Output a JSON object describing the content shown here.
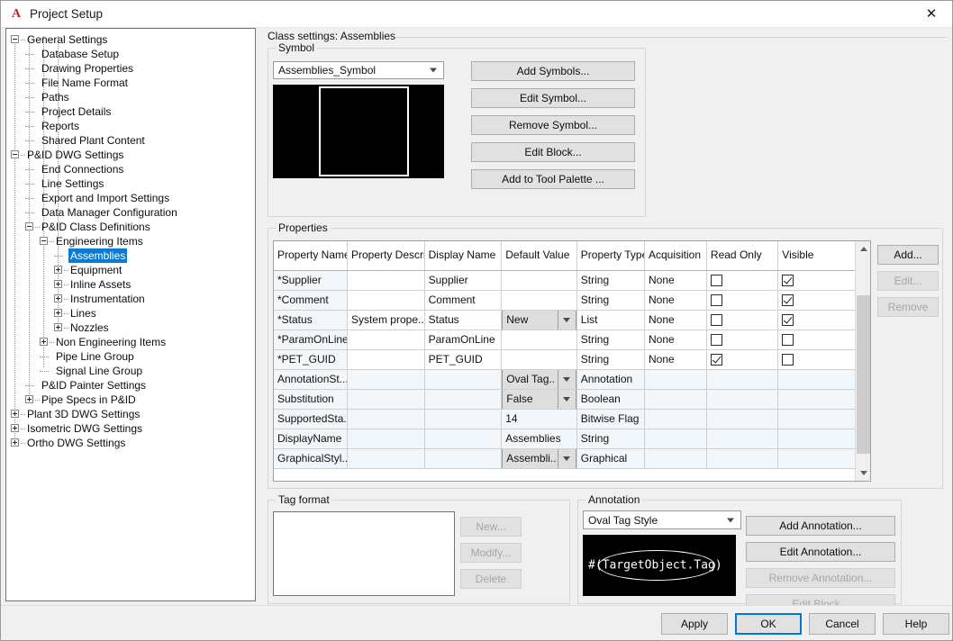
{
  "window": {
    "title": "Project Setup",
    "app_icon": "autocad-a-icon",
    "close_label": "✕"
  },
  "tree": {
    "nodes": [
      {
        "label": "General Settings",
        "depth": 0,
        "toggle": "minus",
        "selected": false
      },
      {
        "label": "Database Setup",
        "depth": 1,
        "toggle": "none",
        "selected": false
      },
      {
        "label": "Drawing Properties",
        "depth": 1,
        "toggle": "none",
        "selected": false
      },
      {
        "label": "File Name Format",
        "depth": 1,
        "toggle": "none",
        "selected": false
      },
      {
        "label": "Paths",
        "depth": 1,
        "toggle": "none",
        "selected": false
      },
      {
        "label": "Project Details",
        "depth": 1,
        "toggle": "none",
        "selected": false
      },
      {
        "label": "Reports",
        "depth": 1,
        "toggle": "none",
        "selected": false
      },
      {
        "label": "Shared Plant Content",
        "depth": 1,
        "toggle": "none",
        "selected": false
      },
      {
        "label": "P&ID DWG Settings",
        "depth": 0,
        "toggle": "minus",
        "selected": false
      },
      {
        "label": "End Connections",
        "depth": 1,
        "toggle": "none",
        "selected": false
      },
      {
        "label": "Line Settings",
        "depth": 1,
        "toggle": "none",
        "selected": false
      },
      {
        "label": "Export and Import Settings",
        "depth": 1,
        "toggle": "none",
        "selected": false
      },
      {
        "label": "Data Manager Configuration",
        "depth": 1,
        "toggle": "none",
        "selected": false
      },
      {
        "label": "P&ID Class Definitions",
        "depth": 1,
        "toggle": "minus",
        "selected": false
      },
      {
        "label": "Engineering Items",
        "depth": 2,
        "toggle": "minus",
        "selected": false
      },
      {
        "label": "Assemblies",
        "depth": 3,
        "toggle": "none",
        "selected": true
      },
      {
        "label": "Equipment",
        "depth": 3,
        "toggle": "plus",
        "selected": false
      },
      {
        "label": "Inline Assets",
        "depth": 3,
        "toggle": "plus",
        "selected": false
      },
      {
        "label": "Instrumentation",
        "depth": 3,
        "toggle": "plus",
        "selected": false
      },
      {
        "label": "Lines",
        "depth": 3,
        "toggle": "plus",
        "selected": false
      },
      {
        "label": "Nozzles",
        "depth": 3,
        "toggle": "plus",
        "selected": false
      },
      {
        "label": "Non Engineering Items",
        "depth": 2,
        "toggle": "plus",
        "selected": false
      },
      {
        "label": "Pipe Line Group",
        "depth": 2,
        "toggle": "none",
        "selected": false
      },
      {
        "label": "Signal Line Group",
        "depth": 2,
        "toggle": "none",
        "selected": false
      },
      {
        "label": "P&ID Painter Settings",
        "depth": 1,
        "toggle": "none",
        "selected": false
      },
      {
        "label": "Pipe Specs in P&ID",
        "depth": 1,
        "toggle": "plus",
        "selected": false
      },
      {
        "label": "Plant 3D DWG Settings",
        "depth": 0,
        "toggle": "plus",
        "selected": false
      },
      {
        "label": "Isometric DWG Settings",
        "depth": 0,
        "toggle": "plus",
        "selected": false
      },
      {
        "label": "Ortho DWG Settings",
        "depth": 0,
        "toggle": "plus",
        "selected": false
      }
    ]
  },
  "content": {
    "class_settings_label": "Class settings: Assemblies",
    "symbol": {
      "group_title": "Symbol",
      "combo_value": "Assemblies_Symbol",
      "buttons": [
        {
          "label": "Add Symbols...",
          "disabled": false
        },
        {
          "label": "Edit Symbol...",
          "disabled": false
        },
        {
          "label": "Remove Symbol...",
          "disabled": false
        },
        {
          "label": "Edit Block...",
          "disabled": false
        },
        {
          "label": "Add to Tool Palette ...",
          "disabled": false
        }
      ]
    },
    "properties": {
      "group_title": "Properties",
      "columns": [
        "Property Name",
        "Property Description",
        "Display Name",
        "Default Value",
        "Property Type",
        "Acquisition",
        "Read Only",
        "Visible"
      ],
      "rows": [
        {
          "name": "*Supplier",
          "description": "",
          "display": "Supplier",
          "default": "",
          "default_kind": "text",
          "type": "String",
          "acquisition": "None",
          "read_only": false,
          "visible": true,
          "has_checks": true,
          "tinted": false
        },
        {
          "name": "*Comment",
          "description": "",
          "display": "Comment",
          "default": "",
          "default_kind": "text",
          "type": "String",
          "acquisition": "None",
          "read_only": false,
          "visible": true,
          "has_checks": true,
          "tinted": false
        },
        {
          "name": "*Status",
          "description": "System prope...",
          "display": "Status",
          "default": "New",
          "default_kind": "combo",
          "type": "List",
          "acquisition": "None",
          "read_only": false,
          "visible": true,
          "has_checks": true,
          "tinted": false
        },
        {
          "name": "*ParamOnLine",
          "description": "",
          "display": "ParamOnLine",
          "default": "",
          "default_kind": "text",
          "type": "String",
          "acquisition": "None",
          "read_only": false,
          "visible": false,
          "has_checks": true,
          "tinted": false
        },
        {
          "name": "*PET_GUID",
          "description": "",
          "display": "PET_GUID",
          "default": "",
          "default_kind": "text",
          "type": "String",
          "acquisition": "None",
          "read_only": true,
          "visible": false,
          "has_checks": true,
          "tinted": false
        },
        {
          "name": "AnnotationSt...",
          "description": "",
          "display": "",
          "default": "Oval Tag...",
          "default_kind": "combo",
          "type": "Annotation",
          "acquisition": "",
          "read_only": null,
          "visible": null,
          "has_checks": false,
          "tinted": true
        },
        {
          "name": "Substitution",
          "description": "",
          "display": "",
          "default": "False",
          "default_kind": "combo",
          "type": "Boolean",
          "acquisition": "",
          "read_only": null,
          "visible": null,
          "has_checks": false,
          "tinted": true
        },
        {
          "name": "SupportedSta...",
          "description": "",
          "display": "",
          "default": "14",
          "default_kind": "text",
          "type": "Bitwise Flag",
          "acquisition": "",
          "read_only": null,
          "visible": null,
          "has_checks": false,
          "tinted": true
        },
        {
          "name": "DisplayName",
          "description": "",
          "display": "",
          "default": "Assemblies",
          "default_kind": "text",
          "type": "String",
          "acquisition": "",
          "read_only": null,
          "visible": null,
          "has_checks": false,
          "tinted": true
        },
        {
          "name": "GraphicalStyl...",
          "description": "",
          "display": "",
          "default": "Assembli...",
          "default_kind": "combo",
          "type": "Graphical",
          "acquisition": "",
          "read_only": null,
          "visible": null,
          "has_checks": false,
          "tinted": true
        }
      ],
      "buttons": [
        {
          "label": "Add...",
          "disabled": false
        },
        {
          "label": "Edit...",
          "disabled": true
        },
        {
          "label": "Remove",
          "disabled": true
        }
      ]
    },
    "tag_format": {
      "group_title": "Tag format",
      "list_items": [],
      "buttons": [
        {
          "label": "New...",
          "disabled": true
        },
        {
          "label": "Modify...",
          "disabled": true
        },
        {
          "label": "Delete",
          "disabled": true
        }
      ]
    },
    "annotation": {
      "group_title": "Annotation",
      "combo_value": "Oval Tag Style",
      "preview_text": "#(TargetObject.Tag)",
      "buttons": [
        {
          "label": "Add Annotation...",
          "disabled": false
        },
        {
          "label": "Edit Annotation...",
          "disabled": false
        },
        {
          "label": "Remove Annotation...",
          "disabled": true
        },
        {
          "label": "Edit Block...",
          "disabled": true
        }
      ]
    }
  },
  "footer": {
    "buttons": [
      {
        "label": "Apply",
        "default": false
      },
      {
        "label": "OK",
        "default": true
      },
      {
        "label": "Cancel",
        "default": false
      },
      {
        "label": "Help",
        "default": false
      }
    ]
  },
  "colors": {
    "selection": "#0a7ad4",
    "accent": "#0078d7",
    "dialog_bg": "#f0f0f0",
    "row_tint": "#f2f7fc",
    "preview_bg": "#000000"
  }
}
